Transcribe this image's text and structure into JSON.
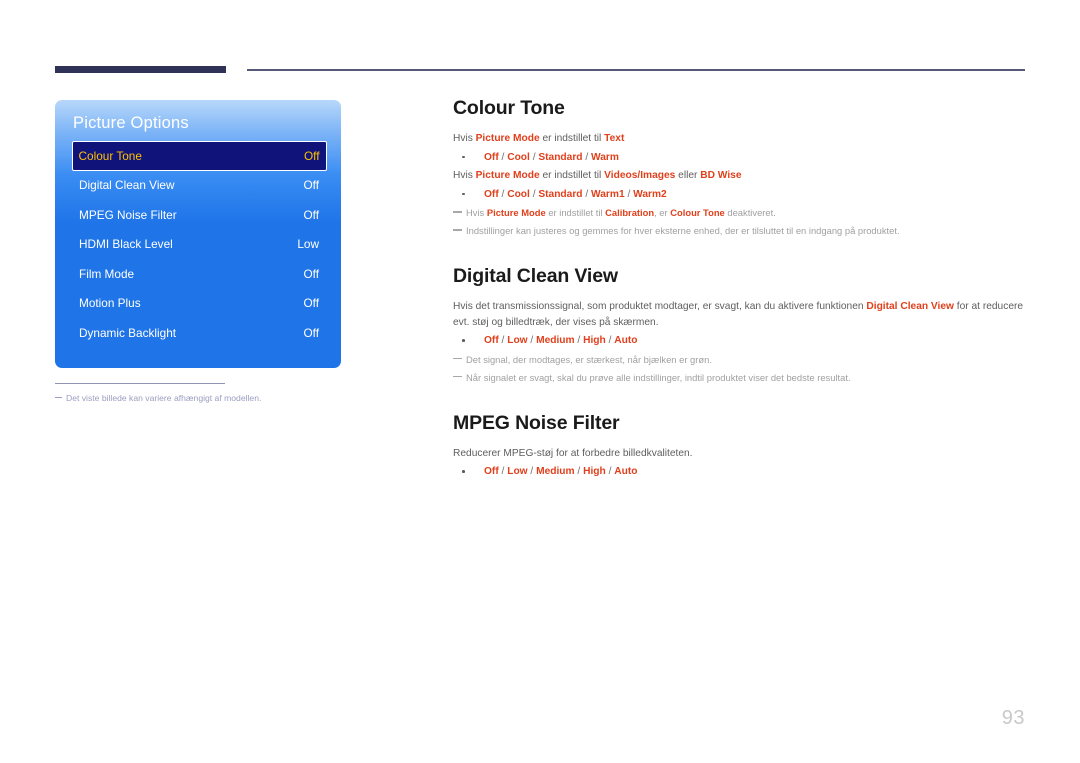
{
  "page": {
    "number": "93"
  },
  "osd": {
    "title": "Picture Options",
    "rows": [
      {
        "label": "Colour Tone",
        "value": "Off",
        "selected": true
      },
      {
        "label": "Digital Clean View",
        "value": "Off",
        "selected": false
      },
      {
        "label": "MPEG Noise Filter",
        "value": "Off",
        "selected": false
      },
      {
        "label": "HDMI Black Level",
        "value": "Low",
        "selected": false
      },
      {
        "label": "Film Mode",
        "value": "Off",
        "selected": false
      },
      {
        "label": "Motion Plus",
        "value": "Off",
        "selected": false
      },
      {
        "label": "Dynamic Backlight",
        "value": "Off",
        "selected": false
      }
    ],
    "footnote": "Det viste billede kan variere afhængigt af modellen."
  },
  "sections": {
    "colour_tone": {
      "heading": "Colour Tone",
      "para1_a": "Hvis ",
      "para1_b": "Picture Mode",
      "para1_c": " er indstillet til ",
      "para1_d": "Text",
      "bullet1": {
        "o1": "Off",
        "s1": " / ",
        "o2": "Cool",
        "s2": " / ",
        "o3": "Standard",
        "s3": " / ",
        "o4": "Warm"
      },
      "para2_a": "Hvis ",
      "para2_b": "Picture Mode",
      "para2_c": " er indstillet til ",
      "para2_d": "Videos/Images",
      "para2_e": " eller ",
      "para2_f": "BD Wise",
      "bullet2": {
        "o1": "Off",
        "s1": " / ",
        "o2": "Cool",
        "s2": " / ",
        "o3": "Standard",
        "s3": " / ",
        "o4": "Warm1",
        "s4": " / ",
        "o5": "Warm2"
      },
      "note1_a": "Hvis ",
      "note1_b": "Picture Mode",
      "note1_c": " er indstillet til ",
      "note1_d": "Calibration",
      "note1_e": ", er ",
      "note1_f": "Colour Tone",
      "note1_g": " deaktiveret.",
      "note2": "Indstillinger kan justeres og gemmes for hver eksterne enhed, der er tilsluttet til en indgang på produktet."
    },
    "digital_clean_view": {
      "heading": "Digital Clean View",
      "para_a": "Hvis det transmissionssignal, som produktet modtager, er svagt, kan du aktivere funktionen ",
      "para_b": "Digital Clean View",
      "para_c": " for at reducere evt. støj og billedtræk, der vises på skærmen.",
      "bullet": {
        "o1": "Off",
        "s1": " / ",
        "o2": "Low",
        "s2": " / ",
        "o3": "Medium",
        "s3": " / ",
        "o4": "High",
        "s4": " / ",
        "o5": "Auto"
      },
      "note1": "Det signal, der modtages, er stærkest, når bjælken er grøn.",
      "note2": "Når signalet er svagt, skal du prøve alle indstillinger, indtil produktet viser det bedste resultat."
    },
    "mpeg_noise_filter": {
      "heading": "MPEG Noise Filter",
      "para": "Reducerer MPEG-støj for at forbedre billedkvaliteten.",
      "bullet": {
        "o1": "Off",
        "s1": " / ",
        "o2": "Low",
        "s2": " / ",
        "o3": "Medium",
        "s3": " / ",
        "o4": "High",
        "s4": " / ",
        "o5": "Auto"
      }
    }
  },
  "colors": {
    "accent_red": "#E0401C",
    "osd_blue": "#1F74E8",
    "osd_selected_bg": "#10137A",
    "osd_selected_text": "#FFC200",
    "rule_navy": "#2F3156"
  }
}
